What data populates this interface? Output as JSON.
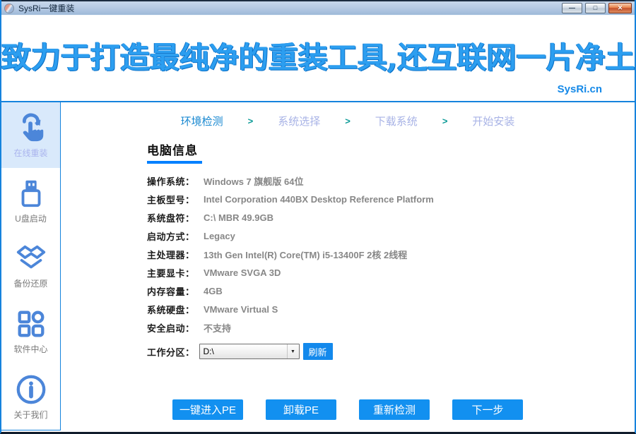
{
  "window": {
    "title": "SysRi一键重装",
    "controls": {
      "minimize": "—",
      "maximize": "□",
      "close": "✕"
    }
  },
  "banner": {
    "headline": "致力于打造最纯净的重装工具,还互联网一片净土",
    "site": "SysRi.cn"
  },
  "sidebar": {
    "items": [
      {
        "label": "在线重装",
        "icon": "hand-refresh-icon",
        "active": true
      },
      {
        "label": "U盘启动",
        "icon": "usb-drive-icon",
        "active": false
      },
      {
        "label": "备份还原",
        "icon": "backup-box-icon",
        "active": false
      },
      {
        "label": "软件中心",
        "icon": "apps-grid-icon",
        "active": false
      },
      {
        "label": "关于我们",
        "icon": "info-circle-icon",
        "active": false
      }
    ]
  },
  "steps": {
    "separator": ">",
    "items": [
      {
        "label": "环境检测",
        "active": true
      },
      {
        "label": "系统选择",
        "active": false
      },
      {
        "label": "下载系统",
        "active": false
      },
      {
        "label": "开始安装",
        "active": false
      }
    ]
  },
  "main": {
    "section_title": "电脑信息",
    "info_rows": [
      {
        "label": "操作系统：",
        "value": "Windows 7 旗舰版  64位"
      },
      {
        "label": "主板型号：",
        "value": "Intel Corporation 440BX Desktop Reference Platform"
      },
      {
        "label": "系统盘符：",
        "value": "C:\\ MBR 49.9GB"
      },
      {
        "label": "启动方式：",
        "value": "Legacy"
      },
      {
        "label": "主处理器：",
        "value": "13th Gen Intel(R) Core(TM) i5-13400F 2核 2线程"
      },
      {
        "label": "主要显卡：",
        "value": "VMware SVGA 3D"
      },
      {
        "label": "内存容量：",
        "value": "4GB"
      },
      {
        "label": "系统硬盘：",
        "value": "VMware Virtual S"
      },
      {
        "label": "安全启动：",
        "value": "不支持"
      }
    ],
    "partition": {
      "label": "工作分区：",
      "selected": "D:\\",
      "dropdown_arrow": "▼",
      "refresh_label": "刷新"
    },
    "buttons": [
      {
        "label": "一键进入PE"
      },
      {
        "label": "卸载PE"
      },
      {
        "label": "重新检测"
      },
      {
        "label": "下一步"
      }
    ]
  },
  "colors": {
    "accent_blue": "#1389ec",
    "icon_blue": "#4c86d9",
    "frame_blue": "#1583dd",
    "headline_blue": "#2c9ef0",
    "step_active": "#1687d0",
    "step_inactive": "#a8b3e6",
    "step_separator_teal": "#0a9a96",
    "value_gray": "#878787",
    "active_item_bg": "#d9e9fb",
    "underline_blue": "#0080ff"
  }
}
